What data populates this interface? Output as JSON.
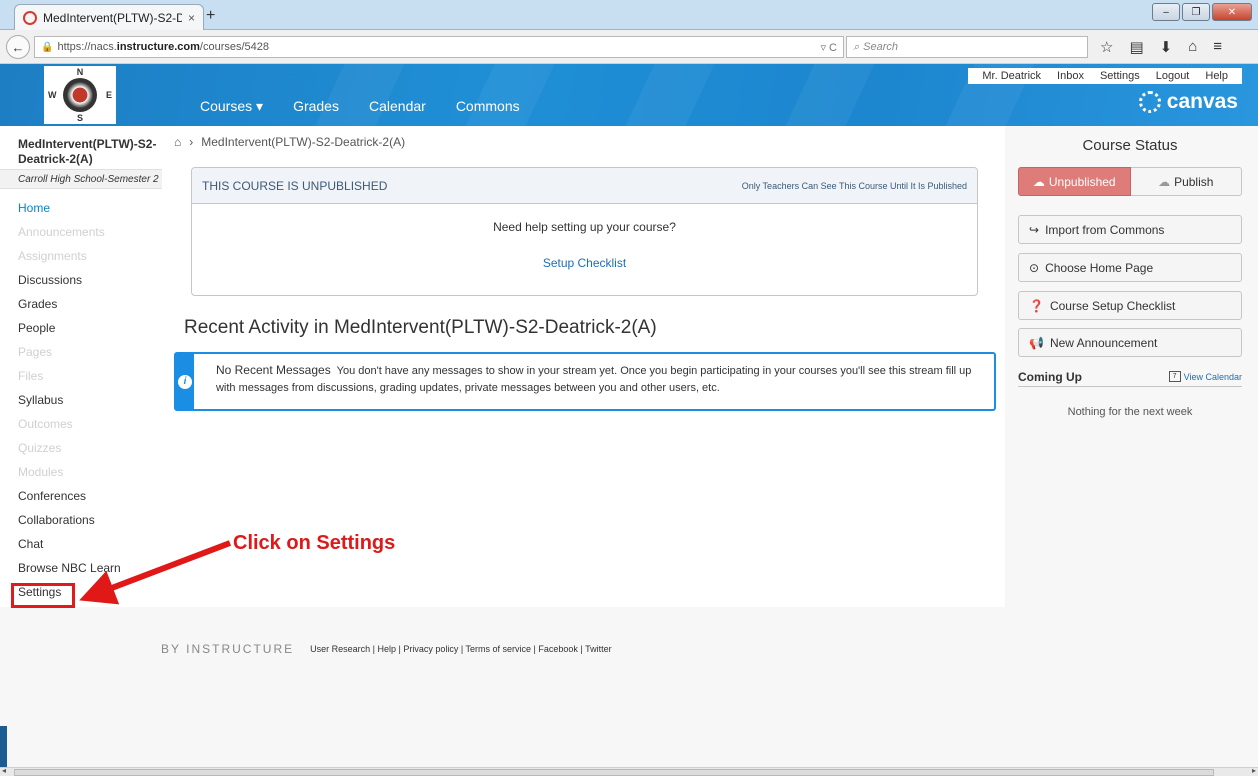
{
  "browser": {
    "tab_title": "MedIntervent(PLTW)-S2-D...",
    "tab_close": "×",
    "new_tab": "+",
    "url_prefix": "https://nacs.",
    "url_domain": "instructure.com",
    "url_path": "/courses/5428",
    "search_placeholder": "Search",
    "window_min": "–",
    "window_max": "❐",
    "window_close": "✕"
  },
  "header": {
    "logo_letters": {
      "n": "N",
      "s": "S",
      "w": "W",
      "e": "E"
    },
    "nav": [
      "Courses ▾",
      "Grades",
      "Calendar",
      "Commons"
    ],
    "user_links": [
      "Mr. Deatrick",
      "Inbox",
      "Settings",
      "Logout",
      "Help"
    ],
    "brand": "canvas"
  },
  "sidebar": {
    "course_name": "MedIntervent(PLTW)-S2-Deatrick-2(A)",
    "term": "Carroll High School-Semester 2",
    "items": [
      {
        "label": "Home",
        "state": "active"
      },
      {
        "label": "Announcements",
        "state": "hidden"
      },
      {
        "label": "Assignments",
        "state": "hidden"
      },
      {
        "label": "Discussions",
        "state": "normal"
      },
      {
        "label": "Grades",
        "state": "normal"
      },
      {
        "label": "People",
        "state": "normal"
      },
      {
        "label": "Pages",
        "state": "hidden"
      },
      {
        "label": "Files",
        "state": "hidden"
      },
      {
        "label": "Syllabus",
        "state": "normal"
      },
      {
        "label": "Outcomes",
        "state": "hidden"
      },
      {
        "label": "Quizzes",
        "state": "hidden"
      },
      {
        "label": "Modules",
        "state": "hidden"
      },
      {
        "label": "Conferences",
        "state": "normal"
      },
      {
        "label": "Collaborations",
        "state": "normal"
      },
      {
        "label": "Chat",
        "state": "normal"
      },
      {
        "label": "Browse NBC Learn",
        "state": "normal"
      },
      {
        "label": "Settings",
        "state": "normal"
      }
    ]
  },
  "main": {
    "breadcrumb": "MedIntervent(PLTW)-S2-Deatrick-2(A)",
    "unpublished_title": "THIS COURSE IS UNPUBLISHED",
    "unpublished_note": "Only Teachers Can See This Course Until It Is Published",
    "help_question": "Need help setting up your course?",
    "setup_link": "Setup Checklist",
    "recent_heading": "Recent Activity in MedIntervent(PLTW)-S2-Deatrick-2(A)",
    "alert_title": "No Recent Messages",
    "alert_body": "You don't have any messages to show in your stream yet. Once you begin participating in your courses you'll see this stream fill up with messages from discussions, grading updates, private messages between you and other users, etc."
  },
  "right": {
    "status_title": "Course Status",
    "unpublished_btn": "Unpublished",
    "publish_btn": "Publish",
    "buttons": [
      "Import from Commons",
      "Choose Home Page",
      "Course Setup Checklist",
      "New Announcement"
    ],
    "coming_up": "Coming Up",
    "view_calendar": "View Calendar",
    "nothing": "Nothing for the next week"
  },
  "footer": {
    "brand": "BY INSTRUCTURE",
    "links": "User Research | Help | Privacy policy | Terms of service | Facebook | Twitter"
  },
  "annotation": {
    "text": "Click on Settings",
    "color": "#e01818"
  }
}
